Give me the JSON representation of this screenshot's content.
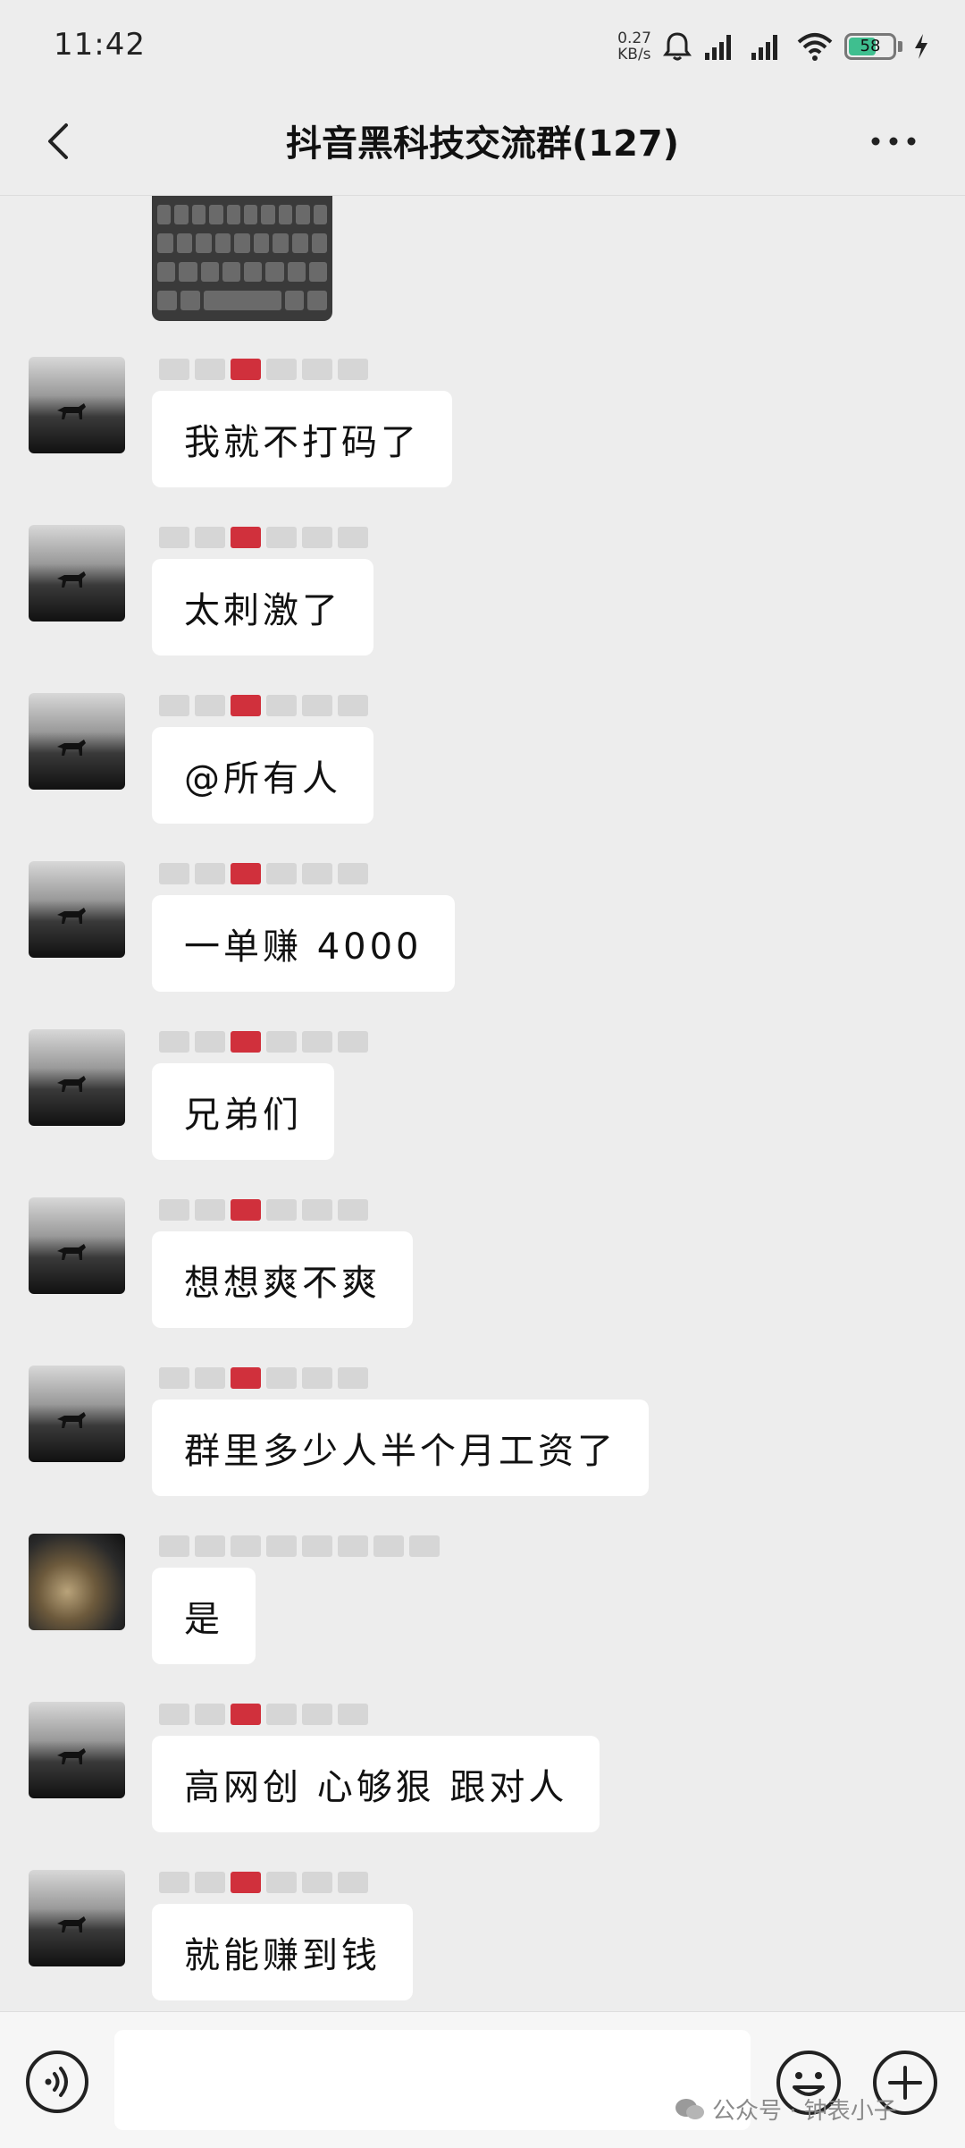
{
  "status_bar": {
    "time": "11:42",
    "net_speed_value": "0.27",
    "net_speed_unit": "KB/s",
    "battery": "58"
  },
  "header": {
    "title": "抖音黑科技交流群(127)"
  },
  "messages": [
    {
      "text": "我就不打码了",
      "avatar": "horse"
    },
    {
      "text": "太刺激了",
      "avatar": "horse"
    },
    {
      "text": "@所有人",
      "avatar": "horse"
    },
    {
      "text": "一单赚 4000",
      "avatar": "horse"
    },
    {
      "text": "兄弟们",
      "avatar": "horse"
    },
    {
      "text": "想想爽不爽",
      "avatar": "horse"
    },
    {
      "text": "群里多少人半个月工资了",
      "avatar": "horse"
    },
    {
      "text": "是",
      "avatar": "bus"
    },
    {
      "text": "高网创 心够狠  跟对人",
      "avatar": "horse"
    },
    {
      "text": "就能赚到钱",
      "avatar": "horse"
    }
  ],
  "watermark": {
    "text": "公众号 · 钟表小子"
  },
  "icons": {
    "back": "chevron-left-icon",
    "more": "more-dots-icon",
    "voice": "voice-icon",
    "emoji": "emoji-icon",
    "plus": "plus-icon"
  },
  "colors": {
    "background": "#ededed",
    "bubble": "#ffffff",
    "battery": "#3fbf8f"
  }
}
